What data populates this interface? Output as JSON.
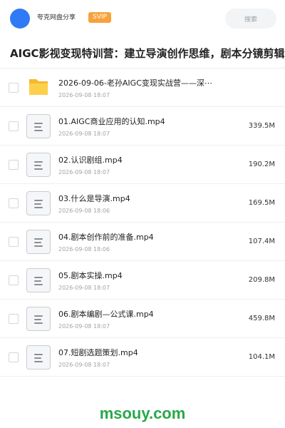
{
  "header": {
    "brand": "夸克网盘分享",
    "badge": "SVIP",
    "search_label": "搜索",
    "accent_color": "#2f7bf6"
  },
  "title": "AIGC影视变现特训营：建立导演创作思维，剧本分镜剪辑，",
  "files": [
    {
      "type": "folder",
      "icon": "folder-icon",
      "name": "2026-09-06-老孙AIGC变现实战营——深⋯",
      "date": "2026-09-08 18:07",
      "size": ""
    },
    {
      "type": "file",
      "icon": "file-icon",
      "name": "01.AIGC商业应用的认知.mp4",
      "date": "2026-09-08 18:07",
      "size": "339.5M"
    },
    {
      "type": "file",
      "icon": "file-icon",
      "name": "02.认识剧组.mp4",
      "date": "2026-09-08 18:07",
      "size": "190.2M"
    },
    {
      "type": "file",
      "icon": "file-icon",
      "name": "03.什么是导演.mp4",
      "date": "2026-09-08 18:06",
      "size": "169.5M"
    },
    {
      "type": "file",
      "icon": "file-icon",
      "name": "04.剧本创作前的准备.mp4",
      "date": "2026-09-08 18:06",
      "size": "107.4M"
    },
    {
      "type": "file",
      "icon": "file-icon",
      "name": "05.剧本实操.mp4",
      "date": "2026-09-08 18:07",
      "size": "209.8M"
    },
    {
      "type": "file",
      "icon": "file-icon",
      "name": "06.剧本编剧—公式课.mp4",
      "date": "2026-09-08 18:07",
      "size": "459.8M"
    },
    {
      "type": "file",
      "icon": "file-icon",
      "name": "07.短剧选题策划.mp4",
      "date": "2026-09-08 18:07",
      "size": "104.1M"
    }
  ],
  "watermark": "msouy.com"
}
